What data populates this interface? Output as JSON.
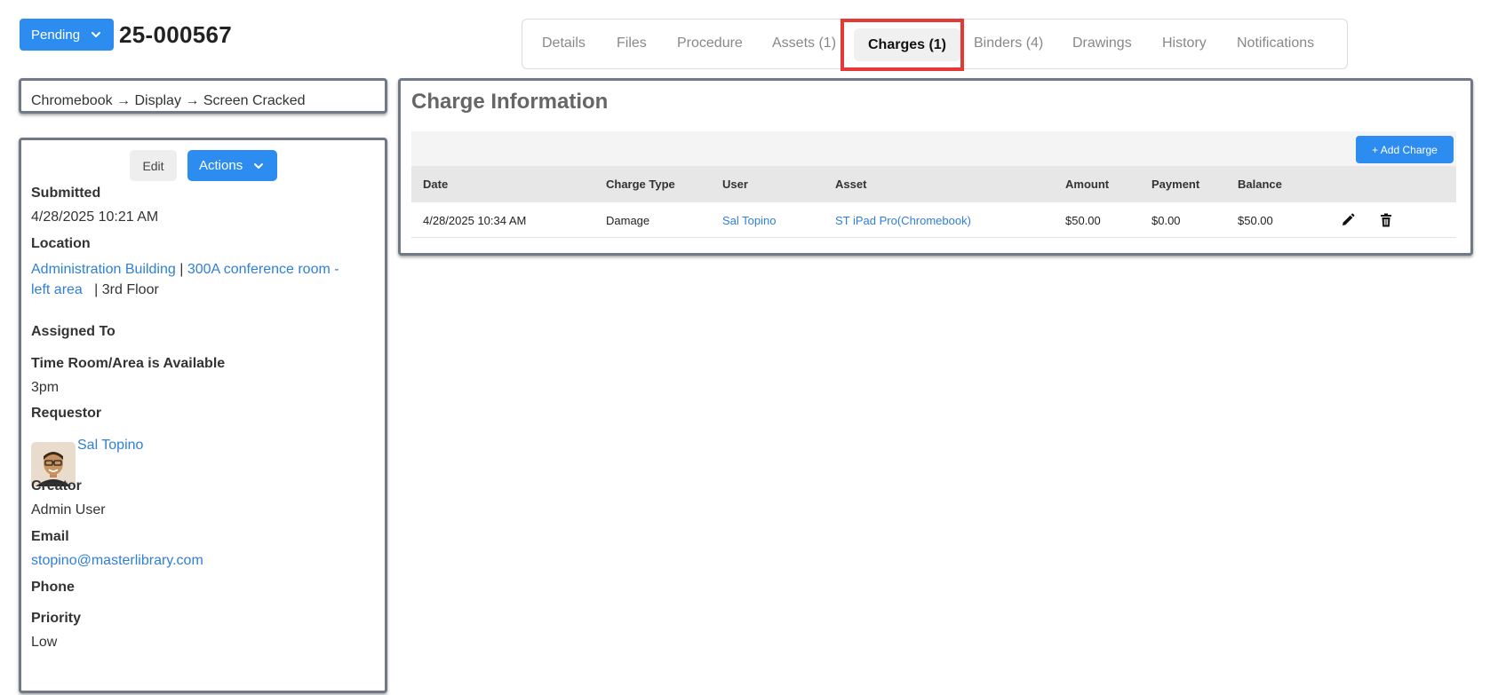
{
  "header": {
    "status": "Pending",
    "ticket_id": "25-000567"
  },
  "tabs": [
    {
      "label": "Details"
    },
    {
      "label": "Files"
    },
    {
      "label": "Procedure"
    },
    {
      "label": "Assets (1)"
    },
    {
      "label": "Charges (1)",
      "active": true
    },
    {
      "label": "Binders (4)"
    },
    {
      "label": "Drawings"
    },
    {
      "label": "History"
    },
    {
      "label": "Notifications"
    }
  ],
  "breadcrumb": "Chromebook → Display → Screen Cracked",
  "info": {
    "edit_label": "Edit",
    "actions_label": "Actions",
    "submitted_label": "Submitted",
    "submitted_value": "4/28/2025 10:21 AM",
    "location_label": "Location",
    "location_building": "Administration Building",
    "location_sep1": "|",
    "location_room_line1": "300A conference room -",
    "location_room_line2": "left area",
    "location_sep2": "|",
    "location_floor": "3rd Floor",
    "assigned_label": "Assigned To",
    "time_label": "Time Room/Area is Available",
    "time_value": "3pm",
    "requestor_label": "Requestor",
    "requestor_name": "Sal Topino",
    "creator_label": "Creator",
    "creator_value": "Admin User",
    "email_label": "Email",
    "email_value": "stopino@masterlibrary.com",
    "phone_label": "Phone",
    "priority_label": "Priority",
    "priority_value": "Low"
  },
  "charges": {
    "title": "Charge Information",
    "add_label": "+ Add Charge",
    "columns": [
      "Date",
      "Charge Type",
      "User",
      "Asset",
      "Amount",
      "Payment",
      "Balance"
    ],
    "rows": [
      {
        "date": "4/28/2025 10:34 AM",
        "type": "Damage",
        "user": "Sal Topino",
        "asset": "ST iPad Pro(Chromebook)",
        "amount": "$50.00",
        "payment": "$0.00",
        "balance": "$50.00"
      }
    ]
  },
  "colors": {
    "primary": "#2d8cf0",
    "link": "#2f7fd6",
    "highlight": "#e53935"
  }
}
